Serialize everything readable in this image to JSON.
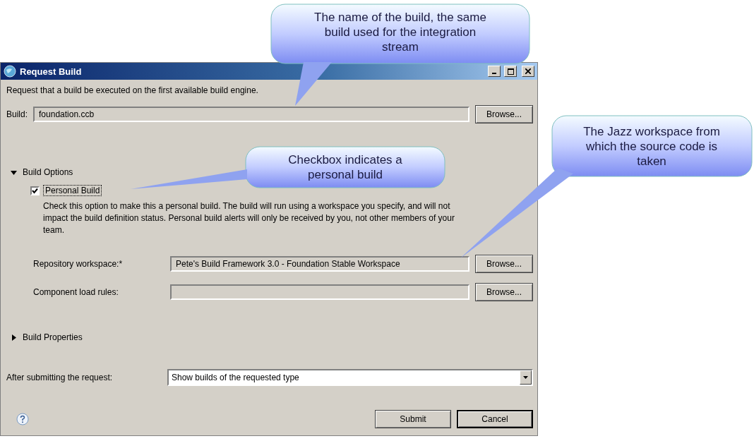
{
  "window": {
    "title": "Request Build"
  },
  "intro": "Request that a build be executed on the first available build engine.",
  "build": {
    "label": "Build:",
    "value": "foundation.ccb",
    "button": "Browse..."
  },
  "build_options": {
    "label": "Build Options",
    "expanded": true,
    "personal_build": {
      "label": "Personal Build",
      "checked": true
    },
    "description": "Check this option to make this a personal build. The build will run using a workspace you specify, and will not impact the build definition status. Personal build alerts will only be received by you, not other members of your team.",
    "fields": [
      {
        "label": "Repository workspace:*",
        "value": "Pete's Build Framework 3.0 - Foundation Stable Workspace",
        "button": "Browse..."
      },
      {
        "label": "Component load rules:",
        "button": "Browse..."
      }
    ]
  },
  "build_properties": {
    "label": "Build Properties",
    "expanded": false
  },
  "after_submit": {
    "label": "After submitting the request:",
    "value": "Show builds of the requested type"
  },
  "buttons": [
    {
      "label": "Submit",
      "default": false
    },
    {
      "label": "Cancel",
      "default": true
    }
  ],
  "callouts": [
    {
      "text": "The name of the build, the same build used for the integration stream"
    },
    {
      "text": "Checkbox indicates a personal build"
    },
    {
      "text": "The Jazz workspace from which the source code is taken"
    }
  ]
}
